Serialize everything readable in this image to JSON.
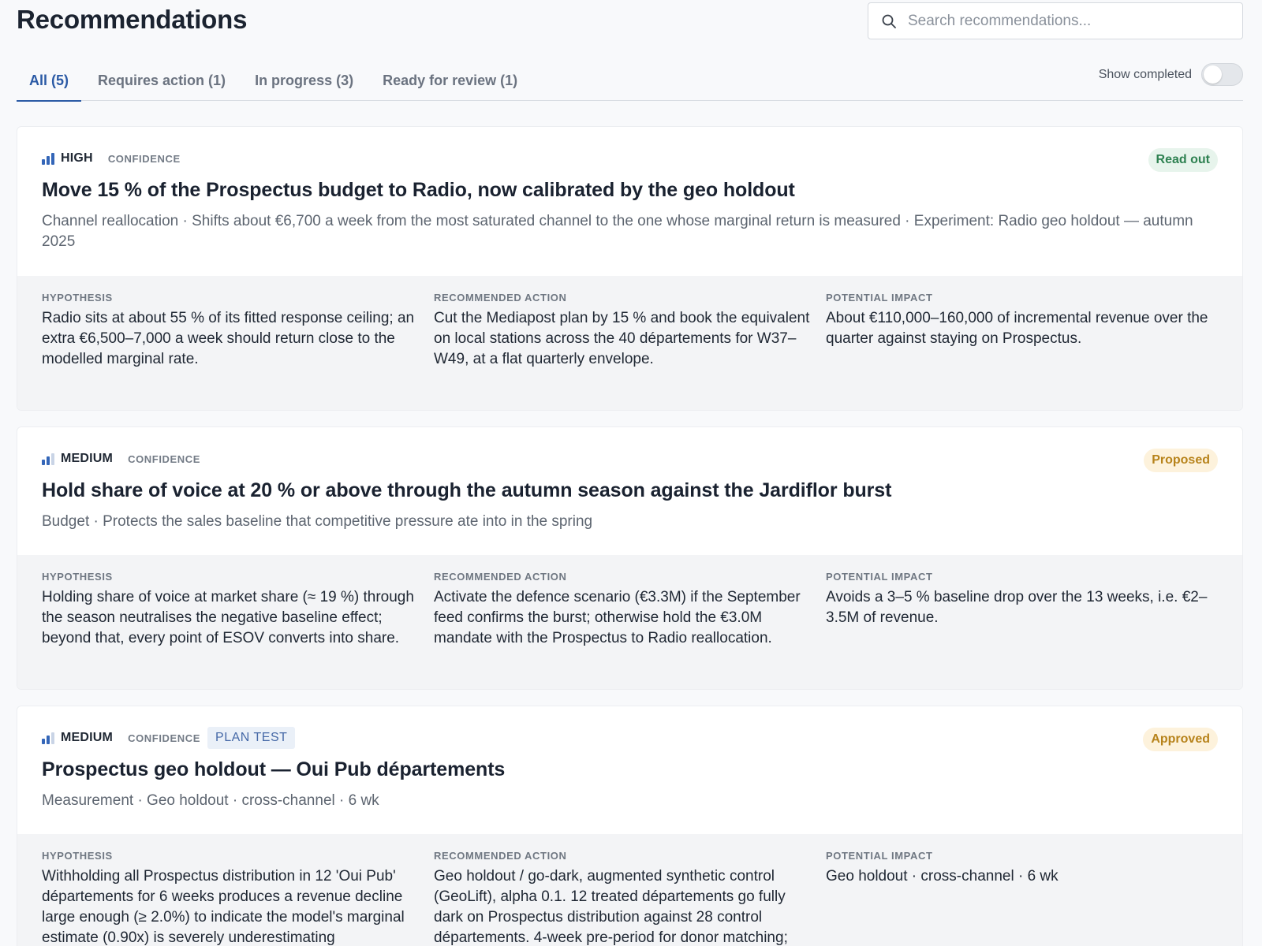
{
  "page_title": "Recommendations",
  "search": {
    "placeholder": "Search recommendations..."
  },
  "tabs": [
    {
      "label": "All (5)",
      "active": true
    },
    {
      "label": "Requires action (1)",
      "active": false
    },
    {
      "label": "In progress (3)",
      "active": false
    },
    {
      "label": "Ready for review (1)",
      "active": false
    }
  ],
  "show_completed": {
    "label": "Show completed",
    "on": false
  },
  "colors": {
    "accent": "#2b5aa5",
    "bar_on": "#3466b8",
    "bar_off": "#c9d4e6",
    "read_out_bg": "#e7f4ec",
    "read_out_fg": "#2e8151",
    "proposed_bg": "#fdf2dc",
    "proposed_fg": "#b7831b",
    "approved_bg": "#fdf2dc",
    "approved_fg": "#b7831b"
  },
  "cards": [
    {
      "confidence": "HIGH",
      "confidence_bars_filled": 3,
      "confidence_word": "CONFIDENCE",
      "status": "Read out",
      "title": "Move 15 % of the Prospectus budget to Radio, now calibrated by the geo holdout",
      "subtitle": "Channel reallocation · Shifts about €6,700 a week from the most saturated channel to the one whose marginal return is measured · Experiment: Radio geo holdout — autumn 2025",
      "hypothesis_label": "HYPOTHESIS",
      "hypothesis": "Radio sits at about 55 % of its fitted response ceiling; an extra €6,500–7,000 a week should return close to the modelled marginal rate.",
      "action_label": "RECOMMENDED ACTION",
      "action": "Cut the Mediapost plan by 15 % and book the equivalent on local stations across the 40 départements for W37–W49, at a flat quarterly envelope.",
      "impact_label": "POTENTIAL IMPACT",
      "impact": "About €110,000–160,000 of incremental revenue over the quarter against staying on Prospectus."
    },
    {
      "confidence": "MEDIUM",
      "confidence_bars_filled": 2,
      "confidence_word": "CONFIDENCE",
      "status": "Proposed",
      "title": "Hold share of voice at 20 % or above through the autumn season against the Jardiflor burst",
      "subtitle": "Budget · Protects the sales baseline that competitive pressure ate into in the spring",
      "hypothesis_label": "HYPOTHESIS",
      "hypothesis": "Holding share of voice at market share (≈ 19 %) through the season neutralises the negative baseline effect; beyond that, every point of ESOV converts into share.",
      "action_label": "RECOMMENDED ACTION",
      "action": "Activate the defence scenario (€3.3M) if the September feed confirms the burst; otherwise hold the €3.0M mandate with the Prospectus to Radio reallocation.",
      "impact_label": "POTENTIAL IMPACT",
      "impact": "Avoids a 3–5 % baseline drop over the 13 weeks, i.e. €2–3.5M of revenue."
    },
    {
      "confidence": "MEDIUM",
      "confidence_bars_filled": 2,
      "confidence_word": "CONFIDENCE",
      "tag": "PLAN TEST",
      "status": "Approved",
      "title": "Prospectus geo holdout — Oui Pub départements",
      "subtitle": "Measurement · Geo holdout · cross-channel · 6 wk",
      "hypothesis_label": "HYPOTHESIS",
      "hypothesis": "Withholding all Prospectus distribution in 12 'Oui Pub' départements for 6 weeks produces a revenue decline large enough (≥ 2.0%) to indicate the model's marginal estimate (0.90x) is severely underestimating",
      "action_label": "RECOMMENDED ACTION",
      "action": "Geo holdout / go-dark, augmented synthetic control (GeoLift), alpha 0.1. 12 treated départements go fully dark on Prospectus distribution against 28 control départements. 4-week pre-period for donor matching;",
      "impact_label": "POTENTIAL IMPACT",
      "impact": "Geo holdout · cross-channel · 6 wk"
    }
  ]
}
